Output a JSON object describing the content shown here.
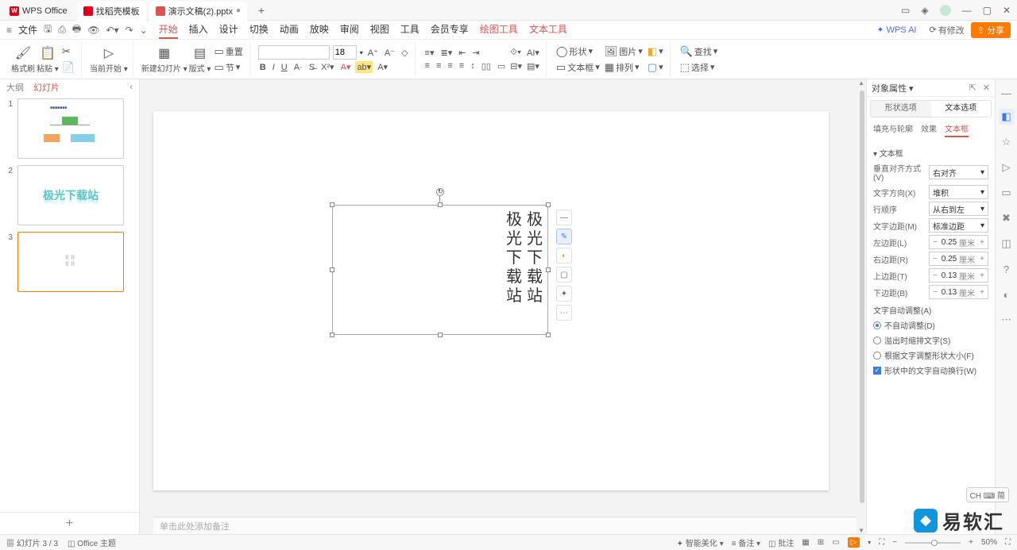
{
  "titlebar": {
    "app_name": "WPS Office",
    "tab_templates": "找稻壳模板",
    "tab_document": "演示文稿(2).pptx"
  },
  "menu": {
    "file": "文件",
    "tabs": [
      "开始",
      "插入",
      "设计",
      "切换",
      "动画",
      "放映",
      "审阅",
      "视图",
      "工具",
      "会员专享",
      "绘图工具",
      "文本工具"
    ],
    "active": 0,
    "colored": [
      10,
      11
    ],
    "wps_ai": "WPS AI",
    "mod": "有修改",
    "share": "分享"
  },
  "ribbon": {
    "format_painter": "格式刷",
    "paste": "粘贴",
    "current_start": "当前开始",
    "new_slide": "新建幻灯片",
    "layout": "版式",
    "section": "节",
    "reset": "重置",
    "font_size": "18",
    "shape": "形状",
    "picture": "图片",
    "textbox": "文本框",
    "arrange": "排列",
    "find": "查找",
    "select": "选择"
  },
  "side": {
    "outline": "大纲",
    "slides": "幻灯片",
    "thumb2_text": "极光下载站"
  },
  "slide": {
    "text_col": [
      "极",
      "光",
      "下",
      "载",
      "站"
    ],
    "notes_placeholder": "单击此处添加备注"
  },
  "props": {
    "title": "对象属性",
    "tab_shape": "形状选项",
    "tab_text": "文本选项",
    "sub_fill": "填充与轮廓",
    "sub_effect": "效果",
    "sub_textbox": "文本框",
    "section_textbox": "文本框",
    "valign_label": "垂直对齐方式(V)",
    "valign_val": "右对齐",
    "dir_label": "文字方向(X)",
    "dir_val": "堆积",
    "order_label": "行顺序",
    "order_val": "从右到左",
    "margin_label": "文字边距(M)",
    "margin_val": "标准边距",
    "l_label": "左边距(L)",
    "l_val": "0.25",
    "l_unit": "厘米",
    "r_label": "右边距(R)",
    "r_val": "0.25",
    "r_unit": "厘米",
    "t_label": "上边距(T)",
    "t_val": "0.13",
    "t_unit": "厘米",
    "b_label": "下边距(B)",
    "b_val": "0.13",
    "b_unit": "厘米",
    "autofit_label": "文字自动调整(A)",
    "opt_noautofit": "不自动调整(D)",
    "opt_shrink": "溢出时缩排文字(S)",
    "opt_resize": "根据文字调整形状大小(F)",
    "wrap": "形状中的文字自动换行(W)"
  },
  "status": {
    "page": "幻灯片 3 / 3",
    "theme": "Office 主题",
    "beautify": "智能美化",
    "notes": "备注",
    "comments": "批注",
    "zoom": "50%"
  },
  "ime": "CH ⌨ 简",
  "watermark": "易软汇"
}
